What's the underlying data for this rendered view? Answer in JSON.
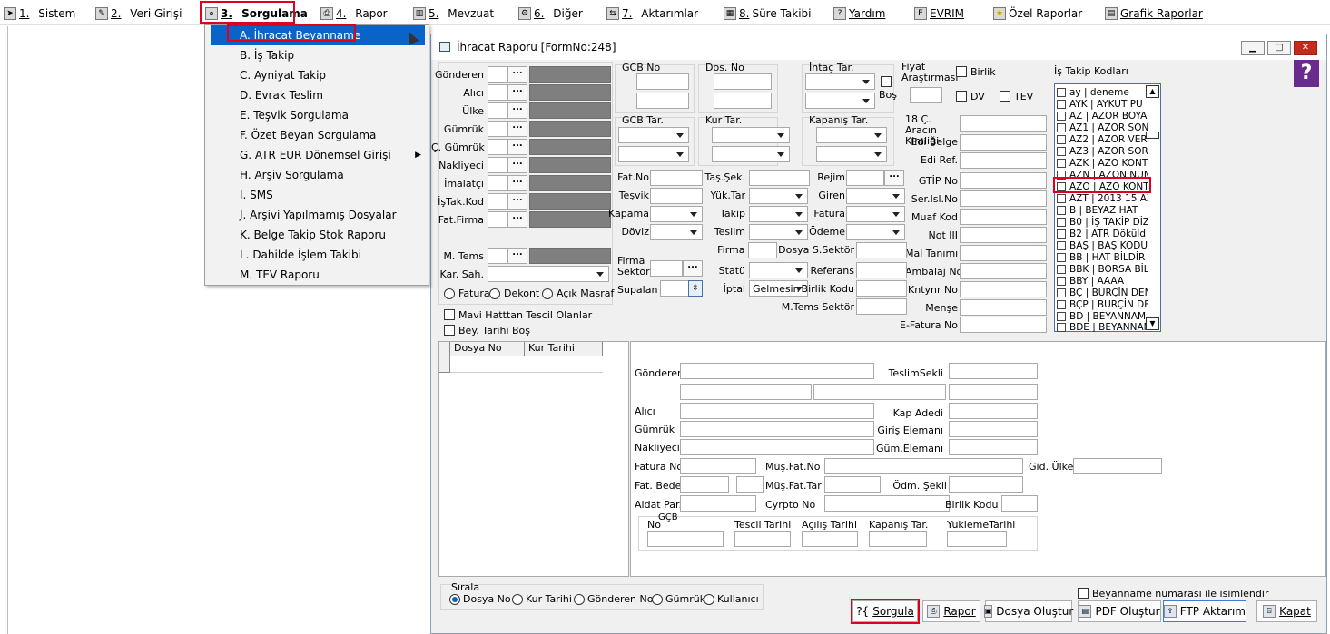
{
  "menubar": {
    "items": [
      {
        "num": "1.",
        "label": "Sistem",
        "icon": "arrow-icon"
      },
      {
        "num": "2.",
        "label": "Veri Girişi",
        "icon": "edit-icon"
      },
      {
        "num": "3.",
        "label": "Sorgulama",
        "icon": "search-icon"
      },
      {
        "num": "4.",
        "label": "Rapor",
        "icon": "printer-icon"
      },
      {
        "num": "5.",
        "label": "Mevzuat",
        "icon": "books-icon"
      },
      {
        "num": "6.",
        "label": "Diğer",
        "icon": "tools-icon"
      },
      {
        "num": "7.",
        "label": "Aktarımlar",
        "icon": "transfer-icon"
      },
      {
        "num": "8.",
        "label": "Süre Takibi",
        "icon": "calendar-icon"
      },
      {
        "num": "",
        "label": "Yardım",
        "icon": "help-icon"
      },
      {
        "num": "",
        "label": "EVRIM",
        "icon": "evrim-icon"
      },
      {
        "num": "",
        "label": "Özel Raporlar",
        "icon": "star-icon"
      },
      {
        "num": "",
        "label": "Grafik Raporlar",
        "icon": "chart-icon"
      }
    ]
  },
  "dropdown": {
    "items": [
      "A.  İhracat Beyanname",
      "B.  İş Takip",
      "C.  Ayniyat Takip",
      "D.  Evrak Teslim",
      "E.  Teşvik Sorgulama",
      "F.  Özet Beyan Sorgulama",
      "G.  ATR EUR Dönemsel Girişi",
      "H.  Arşiv Sorgulama",
      "I.  SMS",
      "J.  Arşivi Yapılmamış Dosyalar",
      "K.  Belge Takip Stok Raporu",
      "L.  Dahilde İşlem Takibi",
      "M.  TEV Raporu"
    ]
  },
  "window": {
    "title": "İhracat Raporu [FormNo:248]",
    "left_labels": [
      "Gönderen",
      "Alıcı",
      "Ülke",
      "Gümrük",
      "Ç. Gümrük",
      "Nakliyeci",
      "İmalatçı",
      "İşTak.Kod",
      "Fat.Firma"
    ],
    "mtems": "M. Tems",
    "karsah": "Kar. Sah.",
    "radios1": [
      "Fatura",
      "Dekont",
      "Açık Masraf"
    ],
    "check_mavi": "Mavi Hatttan Tescil Olanlar",
    "check_bey": "Bey. Tarihi Boş",
    "gcbno": "GCB No",
    "dosno": "Dos. No",
    "intac": "İntaç Tar.",
    "bos": "Boş",
    "gcbtar": "GCB Tar.",
    "kurtar": "Kur Tar.",
    "kapanis": "Kapanış Tar.",
    "fiyat": "Fiyat Araştırması",
    "birlik": "Birlik",
    "dv": "DV",
    "tev": "TEV",
    "arac": "18 Ç. Aracın Kimliği",
    "isTakipKodlari": "İş Takip Kodları",
    "col1_labels": [
      "Fat.No",
      "Teşvik",
      "Kapama",
      "Döviz"
    ],
    "col2_labels": [
      "Taş.Şek.",
      "Yük.Tar",
      "Takip",
      "Teslim"
    ],
    "col3_labels": [
      "Rejim",
      "Giren",
      "Fatura",
      "Ödeme"
    ],
    "col4_labels": [
      "Edi Belge",
      "Edi Ref.",
      "GTİP No",
      "Ser.Isl.No",
      "Muaf Kod",
      "Not III",
      "Mal Tanımı",
      "Ambalaj No",
      "Kntynr No",
      "Menşe",
      "E-Fatura No"
    ],
    "firmagrup": "Firma Grup",
    "dosyasektor": "Dosya S.Sektör",
    "firmasektor": "Firma Sektör",
    "statu": "Statü",
    "referans": "Referans",
    "supalan": "Supalan",
    "iptal": "İptal",
    "iptal_value": "Gelmesin",
    "birlikkodu": "Birlik Kodu",
    "mtemssektor": "M.Tems Sektör",
    "list_items": [
      "ay | deneme",
      "AYK | AYKUT PU",
      "AZ | AZOR BOYA",
      "AZ1 | AZOR SON",
      "AZ2 | AZOR VER",
      "AZ3 | AZOR SOR",
      "AZK | AZO KONT",
      "AZN | AZON NUM",
      "AZO | AZO KONT",
      "AZT | 2013 15 AZ",
      "B | BEYAZ HAT",
      "B0 | İŞ TAKİP DİZ",
      "B2 | ATR Döküld",
      "BAŞ | BAŞ KODU",
      "BB | HAT BİLDİR",
      "BBK | BORSA BİL",
      "BBY | AAAA",
      "BÇ | BURÇİN DEN",
      "BÇP | BURÇİN DE",
      "BD | BEYANNAM",
      "BDE | BEYANNAM"
    ],
    "grid_headers": [
      "Dosya No",
      "Kur Tarihi"
    ],
    "detail": {
      "gonderen": "Gönderen",
      "teslimsekli": "TeslimSekli",
      "alici": "Alıcı",
      "kapadedi": "Kap Adedi",
      "gumruk": "Gümrük",
      "giriseleman": "Giriş Elemanı",
      "nakliyeci": "Nakliyeci",
      "gumeleman": "Güm.Elemanı",
      "faturano": "Fatura No",
      "musfatno": "Müş.Fat.No",
      "gidulke": "Gid. Ülke",
      "fatbedeli": "Fat. Bedeli",
      "musfattar": "Müş.Fat.Tar",
      "odmsekli": "Ödm. Şekli",
      "aidatpar": "Aidat Par.",
      "cyrpto": "Cyrpto No",
      "birlikkodu": "Birlik Kodu",
      "gcb_group": "GÇB",
      "no": "No",
      "tescil": "Tescil Tarihi",
      "acilis": "Açılış Tarihi",
      "kapanis": "Kapanış Tar.",
      "yukleme": "YuklemeTarihi"
    },
    "sirala": "Sırala",
    "sort_options": [
      "Dosya No",
      "Kur Tarihi",
      "Gönderen No",
      "Gümrük",
      "Kullanıcı"
    ],
    "bey_check": "Beyanname numarası ile isimlendir",
    "buttons": {
      "sorgula": "Sorgula",
      "rapor": "Rapor",
      "dosya": "Dosya Oluştur",
      "pdf": "PDF Oluştur",
      "ftp": "FTP Aktarım",
      "kapat": "Kapat"
    }
  }
}
